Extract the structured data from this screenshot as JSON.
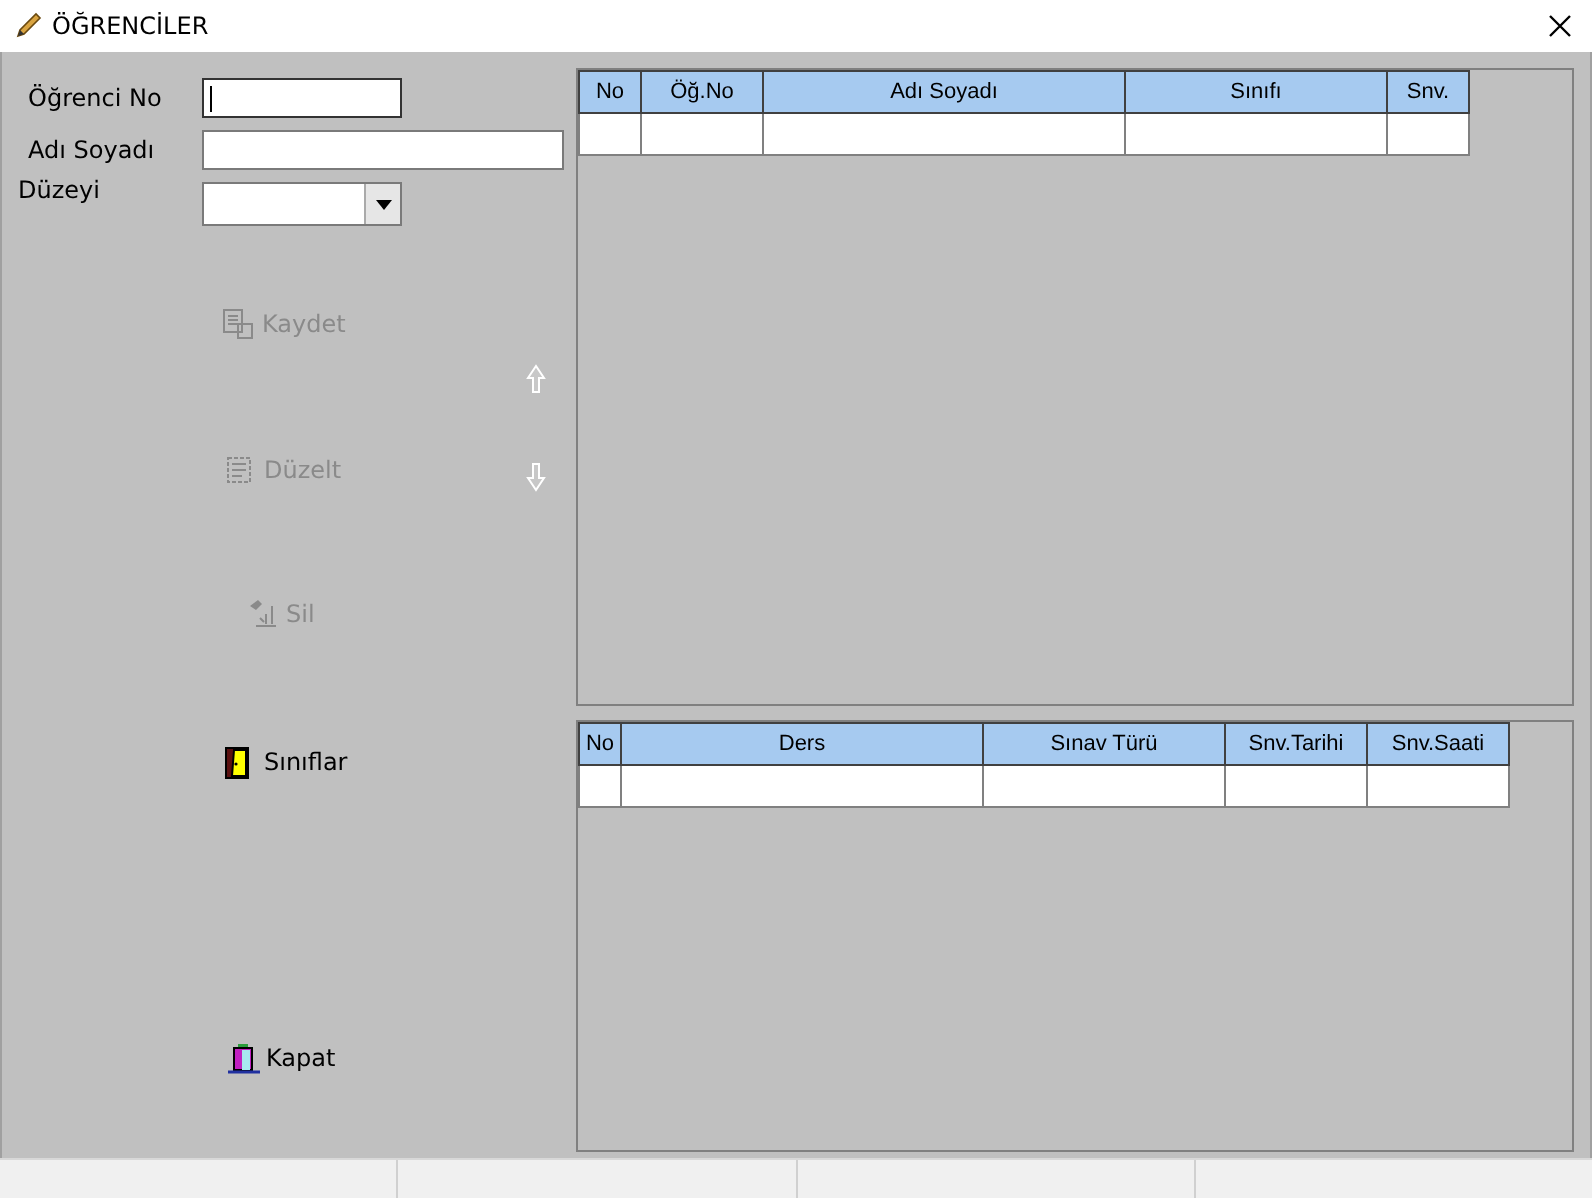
{
  "window": {
    "title": "ÖĞRENCİLER"
  },
  "fields": [
    {
      "kind": "text",
      "label": "Öğrenci No",
      "focused": true
    },
    {
      "kind": "text",
      "label": "Adı Soyadı",
      "focused": false
    },
    {
      "kind": "combo",
      "label": "Düzeyi",
      "focused": false
    }
  ],
  "buttons": [
    {
      "kind": "save",
      "label": "Kaydet",
      "disabled": true
    },
    {
      "kind": "edit",
      "label": "Düzelt",
      "disabled": true
    },
    {
      "kind": "delete",
      "label": "Sil",
      "disabled": true
    },
    {
      "kind": "classes",
      "label": "Sınıflar",
      "disabled": false
    },
    {
      "kind": "close",
      "label": "Kapat",
      "disabled": false
    }
  ],
  "students_table": {
    "columns": [
      "No",
      "Öğ.No",
      "Adı Soyadı",
      "Sınıfı",
      "Snv."
    ]
  },
  "exams_table": {
    "columns": [
      "No",
      "Ders",
      "Sınav Türü",
      "Snv.Tarihi",
      "Snv.Saati"
    ]
  }
}
